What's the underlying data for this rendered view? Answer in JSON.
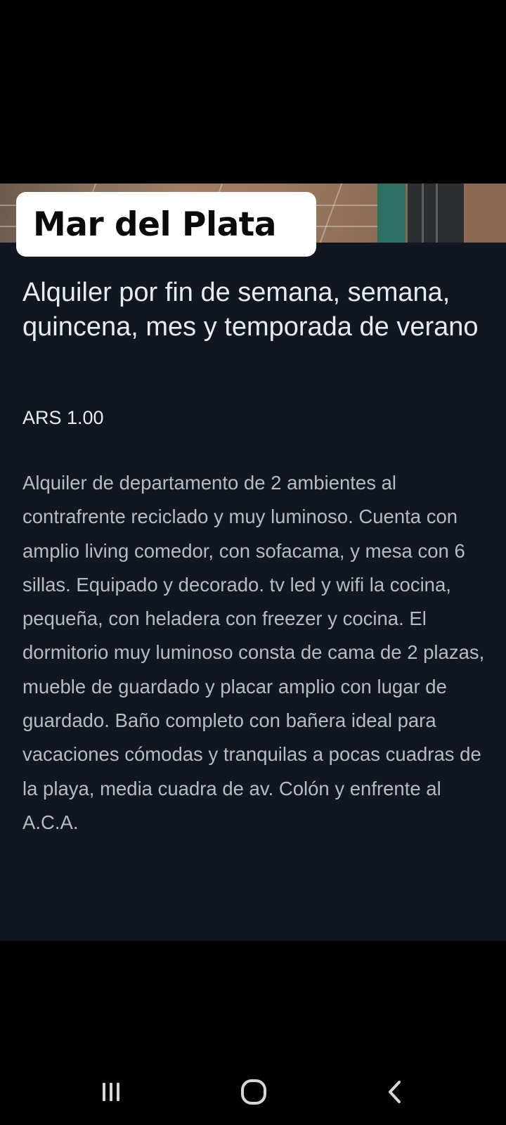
{
  "header": {
    "location": "Mar del Plata"
  },
  "listing": {
    "title": "Alquiler por fin de semana, semana, quincena, mes y temporada de verano",
    "price": "ARS 1.00",
    "description": "Alquiler de departamento de 2 ambientes al contrafrente reciclado y muy luminoso. Cuenta con amplio living comedor, con sofacama, y mesa con 6 sillas. Equipado y decorado. tv led y wifi la cocina, pequeña, con heladera con freezer y cocina.  El dormitorio muy luminoso consta de cama de 2 plazas, mueble de guardado y placar amplio con lugar de guardado. Baño completo con bañera ideal para vacaciones cómodas y tranquilas a pocas cuadras de la playa, media cuadra de av. Colón y enfrente al A.C.A."
  },
  "navigation": {
    "recents_icon": "recent-apps-icon",
    "home_icon": "home-icon",
    "back_icon": "back-icon"
  },
  "colors": {
    "card_background": "#101720",
    "title_text": "#e9ecef",
    "body_text": "#b8bcc1",
    "badge_background": "#ffffff"
  }
}
